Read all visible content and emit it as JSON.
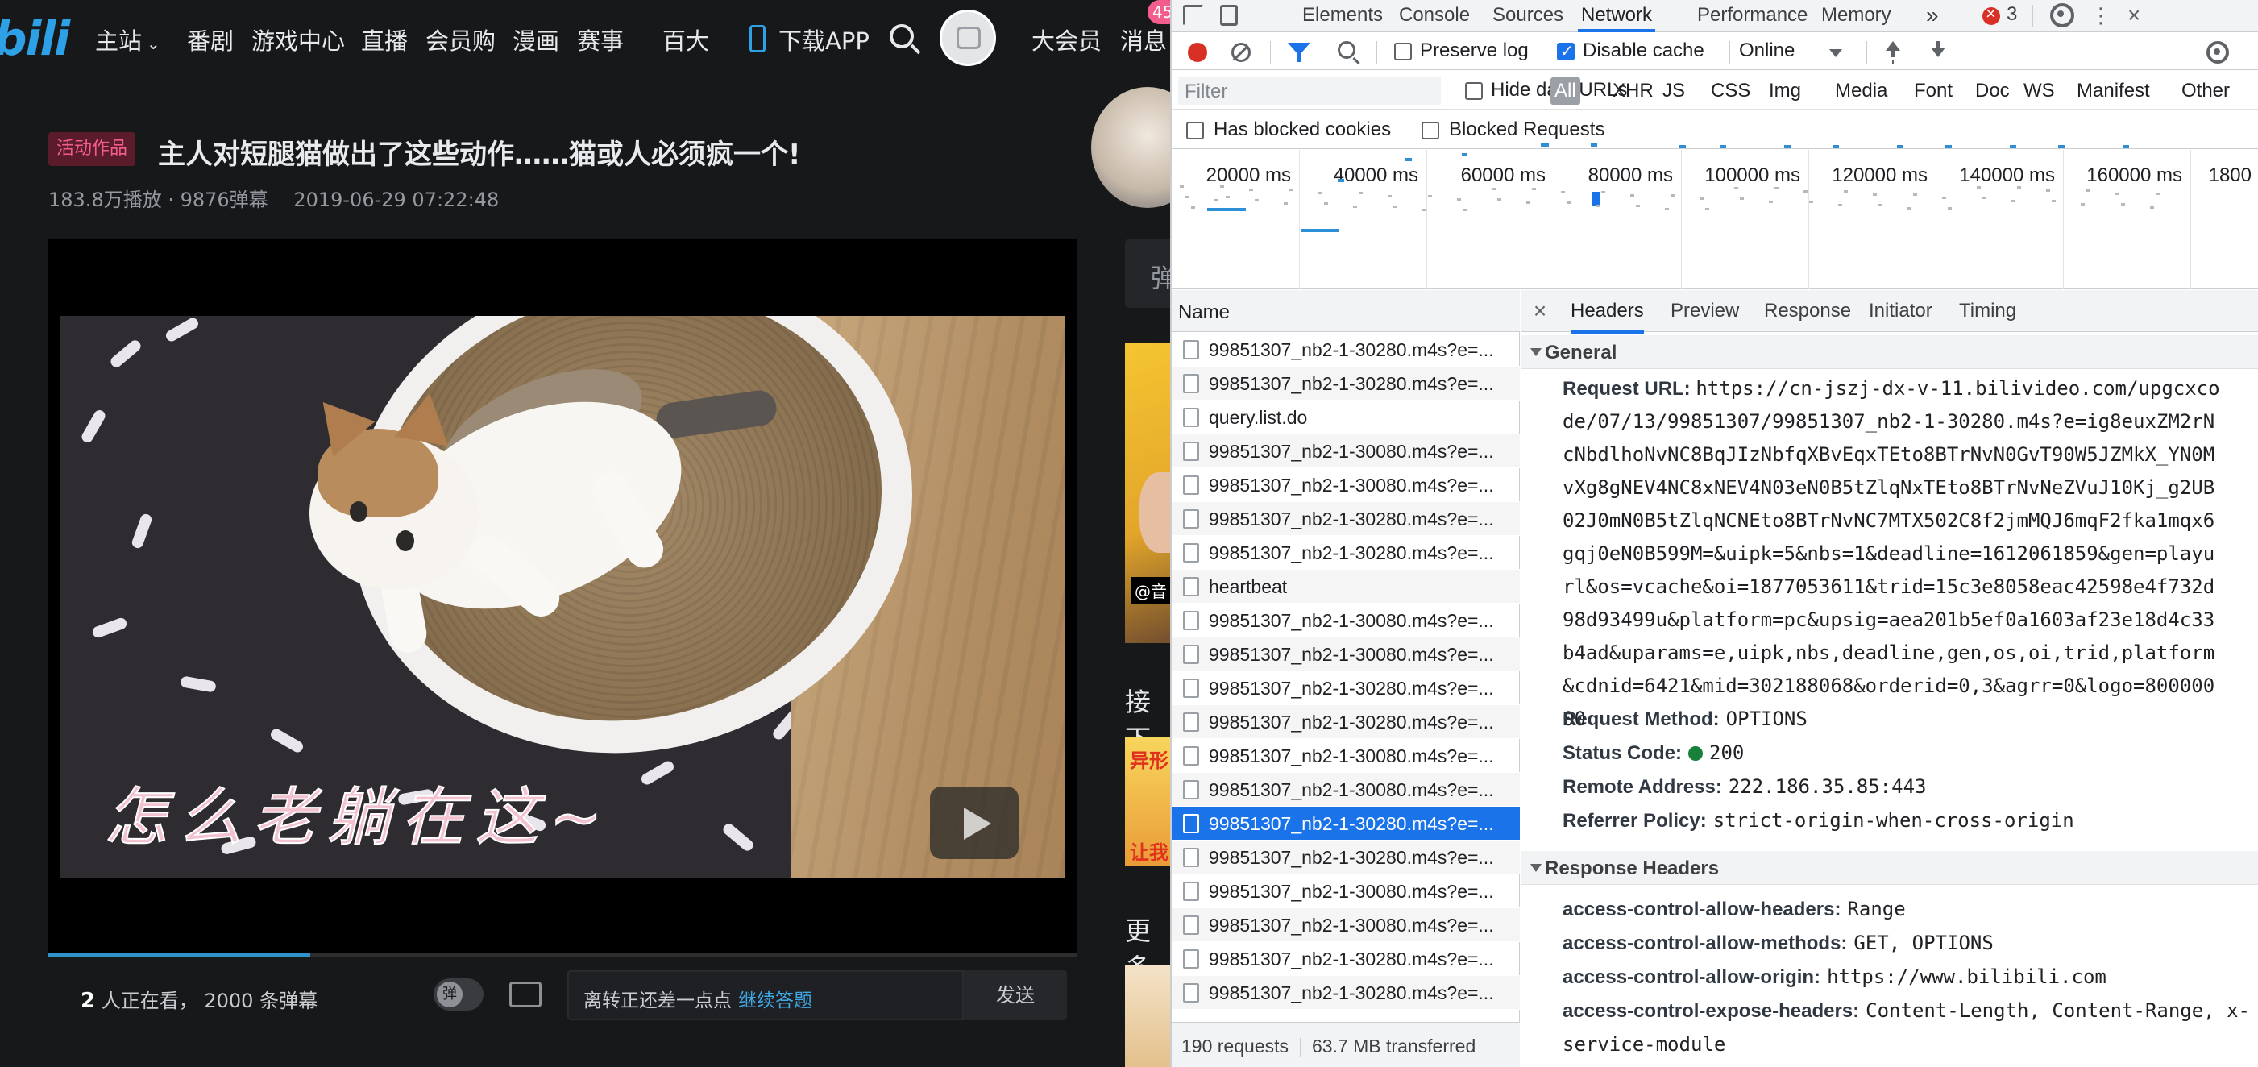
{
  "bilibili": {
    "logo_text": "bili",
    "nav": {
      "home": "主站",
      "anime": "番剧",
      "games": "游戏中心",
      "live": "直播",
      "shop": "会员购",
      "manga": "漫画",
      "esports": "赛事",
      "top100": "百大",
      "download": "下载APP",
      "vip": "大会员",
      "messages": "消息",
      "msg_badge": "45"
    },
    "video": {
      "tag": "活动作品",
      "title": "主人对短腿猫做出了这些动作……猫或人必须疯一个!",
      "views": "183.8万播放 · 9876弹幕",
      "date": "2019-06-29 07:22:48",
      "overlay_subtitle": "怎么老躺在这~",
      "progress": 0.255
    },
    "danmaku": {
      "watching_count": "2",
      "watching_text": "人正在看，",
      "danmaku_count": "2000 条弹幕",
      "input_placeholder": "离转正还差一点点",
      "input_link": "继续答题",
      "send": "发送"
    },
    "side": {
      "danmaku_list_label": "弹",
      "up_next_label": "接下",
      "more_label": "更多",
      "thumb1_tag": "@音",
      "thumb2_top": "异形",
      "thumb2_bottom": "让我"
    }
  },
  "devtools": {
    "tabs": [
      "Elements",
      "Console",
      "Sources",
      "Network",
      "Performance",
      "Memory"
    ],
    "active_tab": "Network",
    "more_tabs": "»",
    "error_count": "3",
    "toolbar": {
      "preserve_log": "Preserve log",
      "preserve_log_checked": false,
      "disable_cache": "Disable cache",
      "disable_cache_checked": true,
      "throttle": "Online"
    },
    "filter": {
      "placeholder": "Filter",
      "hide_data_urls": "Hide data URLs",
      "types": [
        "All",
        "XHR",
        "JS",
        "CSS",
        "Img",
        "Media",
        "Font",
        "Doc",
        "WS",
        "Manifest",
        "Other"
      ],
      "active_type": "All",
      "has_blocked_cookies": "Has blocked cookies",
      "blocked_requests": "Blocked Requests"
    },
    "overview_ticks": [
      "20000 ms",
      "40000 ms",
      "60000 ms",
      "80000 ms",
      "100000 ms",
      "120000 ms",
      "140000 ms",
      "160000 ms",
      "1800"
    ],
    "request_list": {
      "header": "Name",
      "rows": [
        "99851307_nb2-1-30280.m4s?e=...",
        "99851307_nb2-1-30280.m4s?e=...",
        "query.list.do",
        "99851307_nb2-1-30080.m4s?e=...",
        "99851307_nb2-1-30080.m4s?e=...",
        "99851307_nb2-1-30280.m4s?e=...",
        "99851307_nb2-1-30280.m4s?e=...",
        "heartbeat",
        "99851307_nb2-1-30080.m4s?e=...",
        "99851307_nb2-1-30080.m4s?e=...",
        "99851307_nb2-1-30280.m4s?e=...",
        "99851307_nb2-1-30280.m4s?e=...",
        "99851307_nb2-1-30080.m4s?e=...",
        "99851307_nb2-1-30080.m4s?e=...",
        "99851307_nb2-1-30280.m4s?e=...",
        "99851307_nb2-1-30280.m4s?e=...",
        "99851307_nb2-1-30080.m4s?e=...",
        "99851307_nb2-1-30080.m4s?e=...",
        "99851307_nb2-1-30280.m4s?e=...",
        "99851307_nb2-1-30280.m4s?e=..."
      ],
      "selected_index": 14,
      "footer_requests": "190 requests",
      "footer_transferred": "63.7 MB transferred"
    },
    "detail": {
      "close": "×",
      "tabs": [
        "Headers",
        "Preview",
        "Response",
        "Initiator",
        "Timing"
      ],
      "active_tab": "Headers",
      "general_title": "General",
      "request_url_label": "Request URL:",
      "request_url": "https://cn-jszj-dx-v-11.bilivideo.com/upgcxcode/07/13/99851307/99851307_nb2-1-30280.m4s?e=ig8euxZM2rNcNbdlhoNvNC8BqJIzNbfqXBvEqxTEto8BTrNvN0GvT90W5JZMkX_YN0MvXg8gNEV4NC8xNEV4N03eN0B5tZlqNxTEto8BTrNvNeZVuJ10Kj_g2UB02J0mN0B5tZlqNCNEto8BTrNvNC7MTX502C8f2jmMQJ6mqF2fka1mqx6gqj0eN0B599M=&uipk=5&nbs=1&deadline=1612061859&gen=playurl&os=vcache&oi=1877053611&trid=15c3e8058eac42598e4f732d98d93499u&platform=pc&upsig=aea201b5ef0a1603af23e18d4c33b4ad&uparams=e,uipk,nbs,deadline,gen,os,oi,trid,platform&cdnid=6421&mid=302188068&orderid=0,3&agrr=0&logo=80000000",
      "request_method_label": "Request Method:",
      "request_method": "OPTIONS",
      "status_code_label": "Status Code:",
      "status_code": "200",
      "remote_address_label": "Remote Address:",
      "remote_address": "222.186.35.85:443",
      "referrer_policy_label": "Referrer Policy:",
      "referrer_policy": "strict-origin-when-cross-origin",
      "response_headers_title": "Response Headers",
      "response_headers": [
        {
          "k": "access-control-allow-headers:",
          "v": "Range"
        },
        {
          "k": "access-control-allow-methods:",
          "v": "GET, OPTIONS"
        },
        {
          "k": "access-control-allow-origin:",
          "v": "https://www.bilibili.com"
        },
        {
          "k": "access-control-expose-headers:",
          "v": "Content-Length, Content-Range, x-"
        },
        {
          "k": "",
          "v": "service-module"
        }
      ]
    }
  }
}
